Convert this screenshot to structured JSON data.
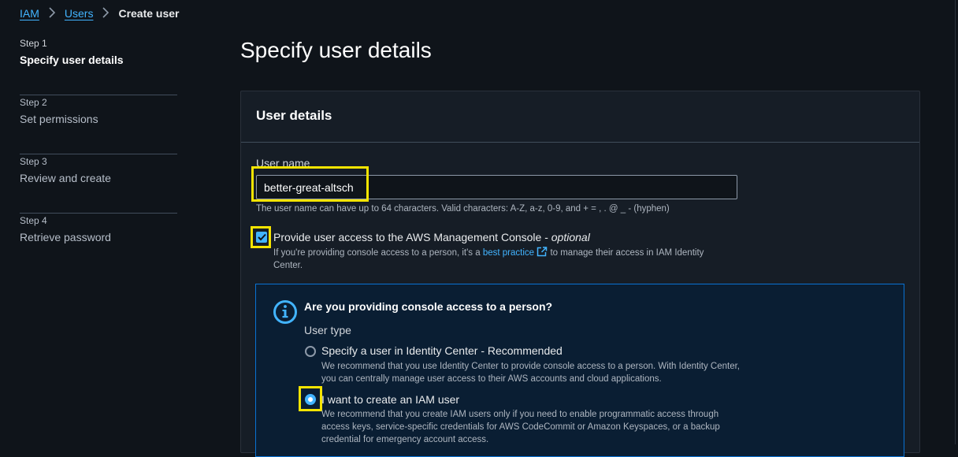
{
  "breadcrumb": {
    "iam": "IAM",
    "users": "Users",
    "current": "Create user"
  },
  "steps": [
    {
      "num": "Step 1",
      "title": "Specify user details"
    },
    {
      "num": "Step 2",
      "title": "Set permissions"
    },
    {
      "num": "Step 3",
      "title": "Review and create"
    },
    {
      "num": "Step 4",
      "title": "Retrieve password"
    }
  ],
  "page_title": "Specify user details",
  "panel": {
    "title": "User details",
    "username_label": "User name",
    "username_value": "better-great-altsch",
    "username_hint": "The user name can have up to 64 characters. Valid characters: A-Z, a-z, 0-9, and + = , . @ _ - (hyphen)",
    "console_access": {
      "label": "Provide user access to the AWS Management Console - ",
      "optional": "optional",
      "checked": true,
      "desc_before": "If you're providing console access to a person, it's a ",
      "desc_link": "best practice",
      "desc_after": " to manage their access in IAM Identity Center."
    },
    "info": {
      "title": "Are you providing console access to a person?",
      "user_type_label": "User type",
      "options": [
        {
          "label": "Specify a user in Identity Center - Recommended",
          "desc": "We recommend that you use Identity Center to provide console access to a person. With Identity Center, you can centrally manage user access to their AWS accounts and cloud applications.",
          "selected": false
        },
        {
          "label": "I want to create an IAM user",
          "desc": "We recommend that you create IAM users only if you need to enable programmatic access through access keys, service-specific credentials for AWS CodeCommit or Amazon Keyspaces, or a backup credential for emergency account access.",
          "selected": true
        }
      ]
    }
  },
  "colors": {
    "accent": "#42b4ff",
    "highlight": "#f5e400",
    "background": "#0f141a",
    "info_border": "#0972d3"
  }
}
